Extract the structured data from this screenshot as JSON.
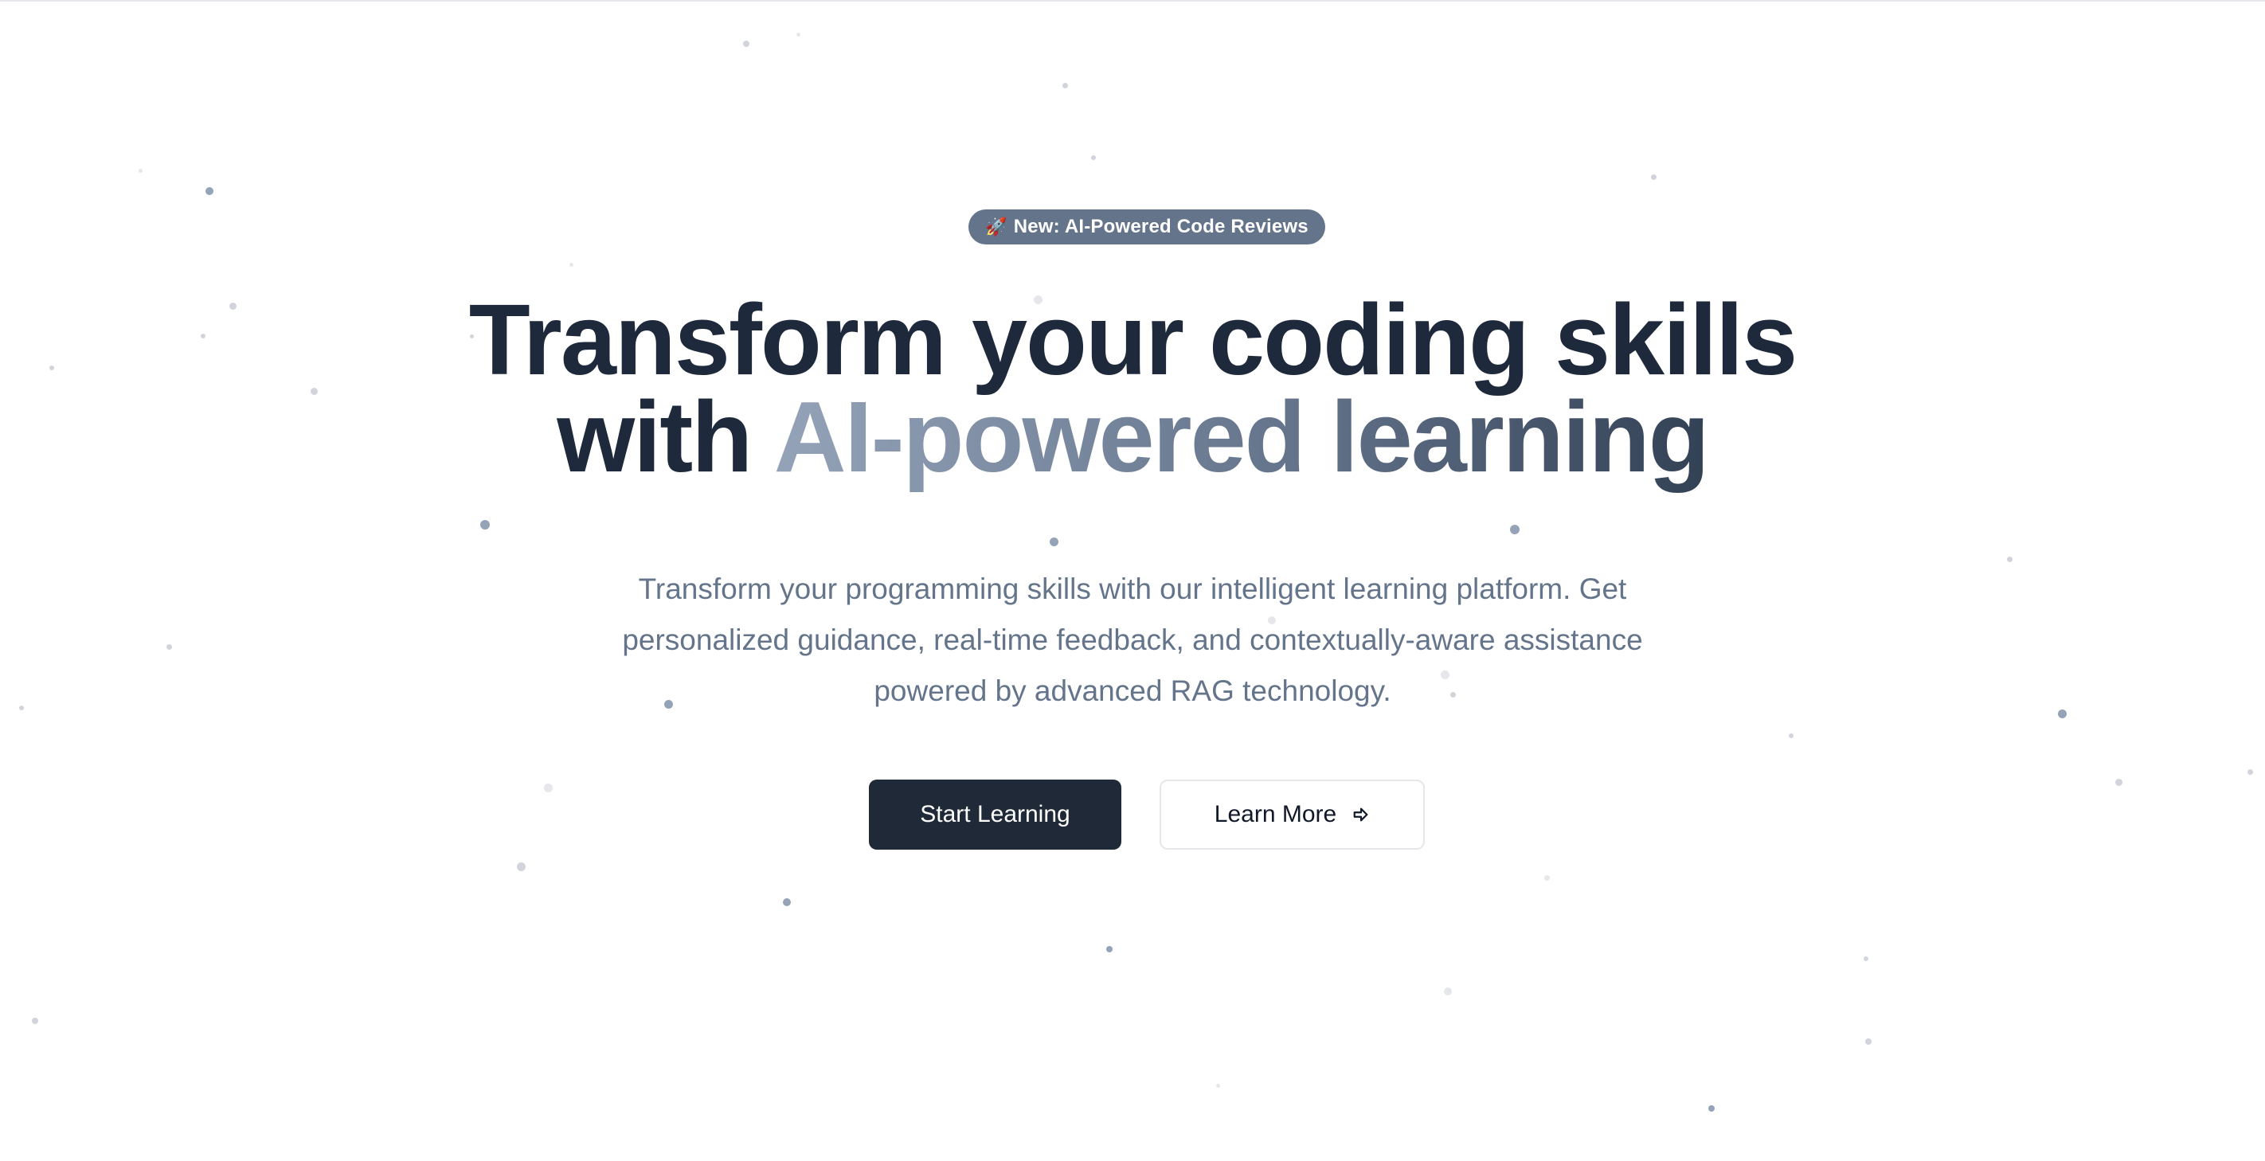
{
  "badge": {
    "icon": "rocket-icon",
    "emoji": "🚀",
    "text": "New: AI-Powered Code Reviews"
  },
  "hero": {
    "title_line1": "Transform your coding skills",
    "title_line2_prefix": "with",
    "title_line2_highlight": "AI-powered learning",
    "subtitle_line1": "Transform your programming skills with our intelligent learning platform. Get",
    "subtitle_line2": "personalized guidance, real-time feedback, and contextually-aware assistance",
    "subtitle_line3": "powered by advanced RAG technology."
  },
  "buttons": {
    "primary_label": "Start Learning",
    "secondary_label": "Learn More",
    "secondary_icon": "arrow-right-icon"
  },
  "colors": {
    "background": "#ffffff",
    "title": "#1e293b",
    "subtitle": "#64748b",
    "badge_bg": "#64748b",
    "primary_button": "#1f2937",
    "gradient_start": "#94a3b8",
    "gradient_end": "#334155"
  }
}
